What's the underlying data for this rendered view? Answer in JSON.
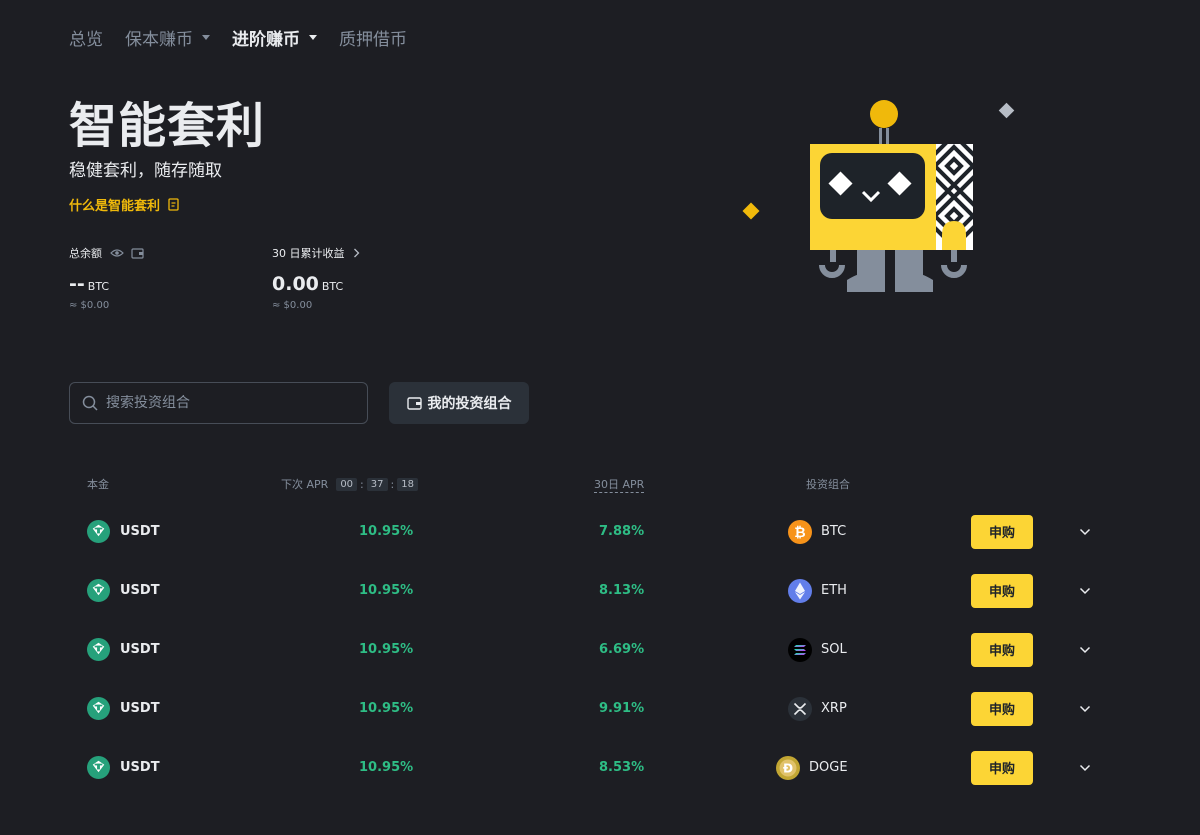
{
  "nav": {
    "items": [
      {
        "label": "总览",
        "dropdown": false,
        "active": false
      },
      {
        "label": "保本赚币",
        "dropdown": true,
        "active": false
      },
      {
        "label": "进阶赚币",
        "dropdown": true,
        "active": true
      },
      {
        "label": "质押借币",
        "dropdown": false,
        "active": false
      }
    ]
  },
  "hero": {
    "title": "智能套利",
    "subtitle": "稳健套利，随存随取",
    "link_label": "什么是智能套利"
  },
  "stats": {
    "balance": {
      "label": "总余额",
      "value": "--",
      "unit": "BTC",
      "usd": "≈ $0.00"
    },
    "earnings": {
      "label": "30 日累计收益",
      "value": "0.00",
      "unit": "BTC",
      "usd": "≈ $0.00"
    }
  },
  "search": {
    "placeholder": "搜索投资组合",
    "value": ""
  },
  "portfolio_button": {
    "label": "我的投资组合"
  },
  "table": {
    "headers": {
      "principal": "本金",
      "next_apr": "下次 APR",
      "timer": [
        "00",
        "37",
        "18"
      ],
      "apr_30d": "30日 APR",
      "portfolio": "投资组合"
    },
    "buy_label": "申购",
    "rows": [
      {
        "coin": "USDT",
        "next_apr": "10.95%",
        "apr_30d": "7.88%",
        "asset": "BTC",
        "icon": "btc-icon"
      },
      {
        "coin": "USDT",
        "next_apr": "10.95%",
        "apr_30d": "8.13%",
        "asset": "ETH",
        "icon": "eth-icon"
      },
      {
        "coin": "USDT",
        "next_apr": "10.95%",
        "apr_30d": "6.69%",
        "asset": "SOL",
        "icon": "sol-icon"
      },
      {
        "coin": "USDT",
        "next_apr": "10.95%",
        "apr_30d": "9.91%",
        "asset": "XRP",
        "icon": "xrp-icon"
      },
      {
        "coin": "USDT",
        "next_apr": "10.95%",
        "apr_30d": "8.53%",
        "asset": "DOGE",
        "icon": "doge-icon"
      }
    ]
  },
  "colors": {
    "background": "#1d1e23",
    "accent": "#fcd535",
    "link": "#f0b90b",
    "positive": "#2ebd85",
    "muted": "#848e9c",
    "usdt": "#26a17b"
  }
}
